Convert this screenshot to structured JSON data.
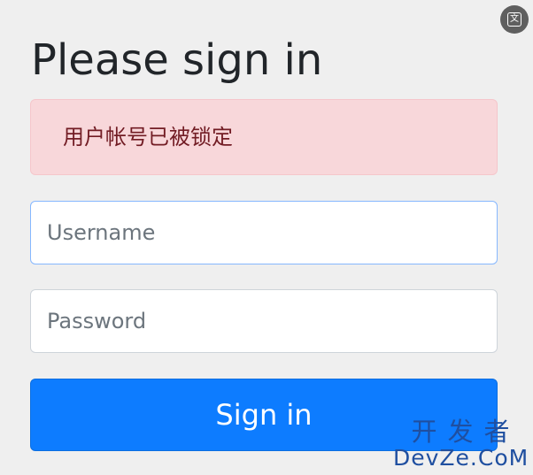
{
  "header": {
    "translate_icon_glyph": "文"
  },
  "form": {
    "title": "Please sign in",
    "alert": {
      "message": "用户帐号已被锁定",
      "background": "#f8d7da",
      "text_color": "#721c24"
    },
    "username": {
      "placeholder": "Username",
      "value": ""
    },
    "password": {
      "placeholder": "Password",
      "value": ""
    },
    "submit_label": "Sign in",
    "accent_color": "#0d7cff"
  },
  "watermark": {
    "line1": "开发者",
    "line2": "DevZe.CoM"
  }
}
